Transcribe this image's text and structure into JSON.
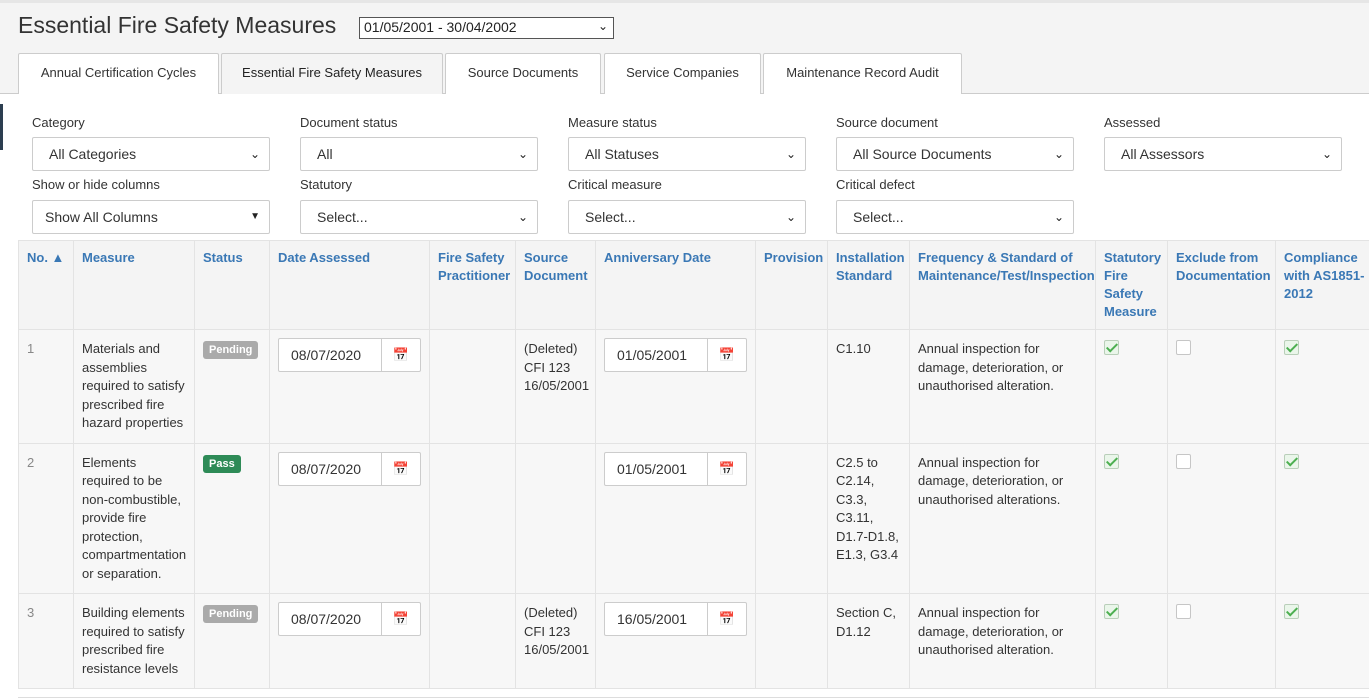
{
  "header": {
    "title": "Essential Fire Safety Measures",
    "period": "01/05/2001 - 30/04/2002"
  },
  "tabs": [
    {
      "label": "Annual Certification Cycles",
      "active": false
    },
    {
      "label": "Essential Fire Safety Measures",
      "active": true
    },
    {
      "label": "Source Documents",
      "active": false
    },
    {
      "label": "Service Companies",
      "active": false
    },
    {
      "label": "Maintenance Record Audit",
      "active": false
    }
  ],
  "filters": {
    "category": {
      "label": "Category",
      "value": "All Categories"
    },
    "document_status": {
      "label": "Document status",
      "value": "All"
    },
    "measure_status": {
      "label": "Measure status",
      "value": "All Statuses"
    },
    "source_document": {
      "label": "Source document",
      "value": "All Source Documents"
    },
    "assessed": {
      "label": "Assessed",
      "value": "All Assessors"
    },
    "columns": {
      "label": "Show or hide columns",
      "value": "Show All Columns"
    },
    "statutory": {
      "label": "Statutory",
      "value": "Select..."
    },
    "critical_measure": {
      "label": "Critical measure",
      "value": "Select..."
    },
    "critical_defect": {
      "label": "Critical defect",
      "value": "Select..."
    }
  },
  "table": {
    "columns": [
      "No. ▲",
      "Measure",
      "Status",
      "Date Assessed",
      "Fire Safety Practitioner",
      "Source Document",
      "Anniversary Date",
      "Provision",
      "Installation Standard",
      "Frequency & Standard of Maintenance/Test/Inspection",
      "Statutory Fire Safety Measure",
      "Exclude from Documentation",
      "Compliance with AS1851-2012"
    ],
    "rows": [
      {
        "no": "1",
        "measure": "Materials and assemblies required to satisfy prescribed fire hazard properties",
        "status": "Pending",
        "date_assessed": "08/07/2020",
        "practitioner": "",
        "source_document": "(Deleted) CFI 123 16/05/2001",
        "anniversary_date": "01/05/2001",
        "provision": "",
        "installation_standard": "C1.10",
        "frequency": "Annual inspection for damage, deterioration, or unauthorised alteration.",
        "statutory": true,
        "exclude": false,
        "compliance": true
      },
      {
        "no": "2",
        "measure": "Elements required to be non-combustible, provide fire protection, compartmentation or separation.",
        "status": "Pass",
        "date_assessed": "08/07/2020",
        "practitioner": "",
        "source_document": "",
        "anniversary_date": "01/05/2001",
        "provision": "",
        "installation_standard": "C2.5 to C2.14, C3.3, C3.11, D1.7-D1.8, E1.3, G3.4",
        "frequency": "Annual inspection for damage, deterioration, or unauthorised alterations.",
        "statutory": true,
        "exclude": false,
        "compliance": true
      },
      {
        "no": "3",
        "measure": "Building elements required to satisfy prescribed fire resistance levels",
        "status": "Pending",
        "date_assessed": "08/07/2020",
        "practitioner": "",
        "source_document": "(Deleted) CFI 123 16/05/2001",
        "anniversary_date": "16/05/2001",
        "provision": "",
        "installation_standard": "Section C, D1.12",
        "frequency": "Annual inspection for damage, deterioration, or unauthorised alteration.",
        "statutory": true,
        "exclude": false,
        "compliance": true
      }
    ]
  },
  "colors": {
    "accent": "#3a78b5",
    "pending": "#aaaaaa",
    "pass": "#2e8b57",
    "check": "#4caf50"
  }
}
